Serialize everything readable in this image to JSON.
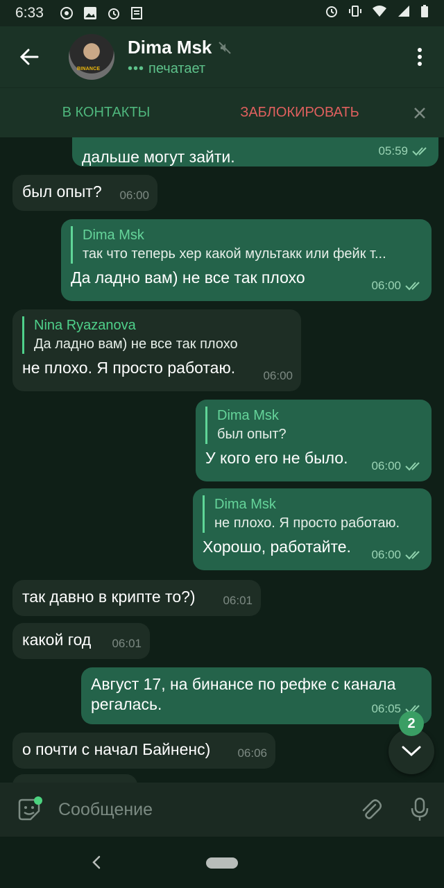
{
  "status_bar": {
    "time": "6:33"
  },
  "header": {
    "contact_name": "Dima Msk",
    "status_dots": "•••",
    "status": "печатает",
    "avatar_badge": "BINANCE"
  },
  "action_bar": {
    "add_contact": "В КОНТАКТЫ",
    "block": "ЗАБЛОКИРОВАТЬ"
  },
  "messages": [
    {
      "dir": "out",
      "text": "дальше могут зайти.",
      "time": "05:59"
    },
    {
      "dir": "in",
      "text": "был опыт?",
      "time": "06:00"
    },
    {
      "dir": "out",
      "reply_name": "Dima Msk",
      "reply_text": "так что теперь хер какой мультакк или фейк т...",
      "text": "Да ладно вам) не все так плохо",
      "time": "06:00"
    },
    {
      "dir": "in",
      "reply_name": "Nina Ryazanova",
      "reply_text": "Да ладно вам) не все так плохо",
      "text": "не плохо. Я просто работаю.",
      "time": "06:00"
    },
    {
      "dir": "out",
      "reply_name": "Dima Msk",
      "reply_text": "был опыт?",
      "text": "У кого его не было.",
      "time": "06:00"
    },
    {
      "dir": "out",
      "reply_name": "Dima Msk",
      "reply_text": "не плохо. Я просто работаю.",
      "text": "Хорошо, работайте.",
      "time": "06:00"
    },
    {
      "dir": "in",
      "text": "так давно в крипте то?)",
      "time": "06:01"
    },
    {
      "dir": "in",
      "text": "какой год",
      "time": "06:01"
    },
    {
      "dir": "out",
      "text": "Август 17, на бинансе по рефке с канала регалась.",
      "time": "06:05"
    },
    {
      "dir": "in",
      "text": "о почти с начал Байненс)",
      "time": "06:06"
    }
  ],
  "unread_count": "2",
  "input": {
    "placeholder": "Сообщение"
  },
  "colors": {
    "background": "#0f1f17",
    "header": "#1b3326",
    "incoming_bubble": "#1e2e25",
    "outgoing_bubble": "#24634a",
    "accent_green": "#4fb77d",
    "danger_red": "#e0605e"
  },
  "icons": [
    "back-arrow-icon",
    "muted-icon",
    "more-vert-icon",
    "close-icon",
    "double-check-icon",
    "chevron-down-icon",
    "sticker-icon",
    "attach-icon",
    "mic-icon"
  ]
}
